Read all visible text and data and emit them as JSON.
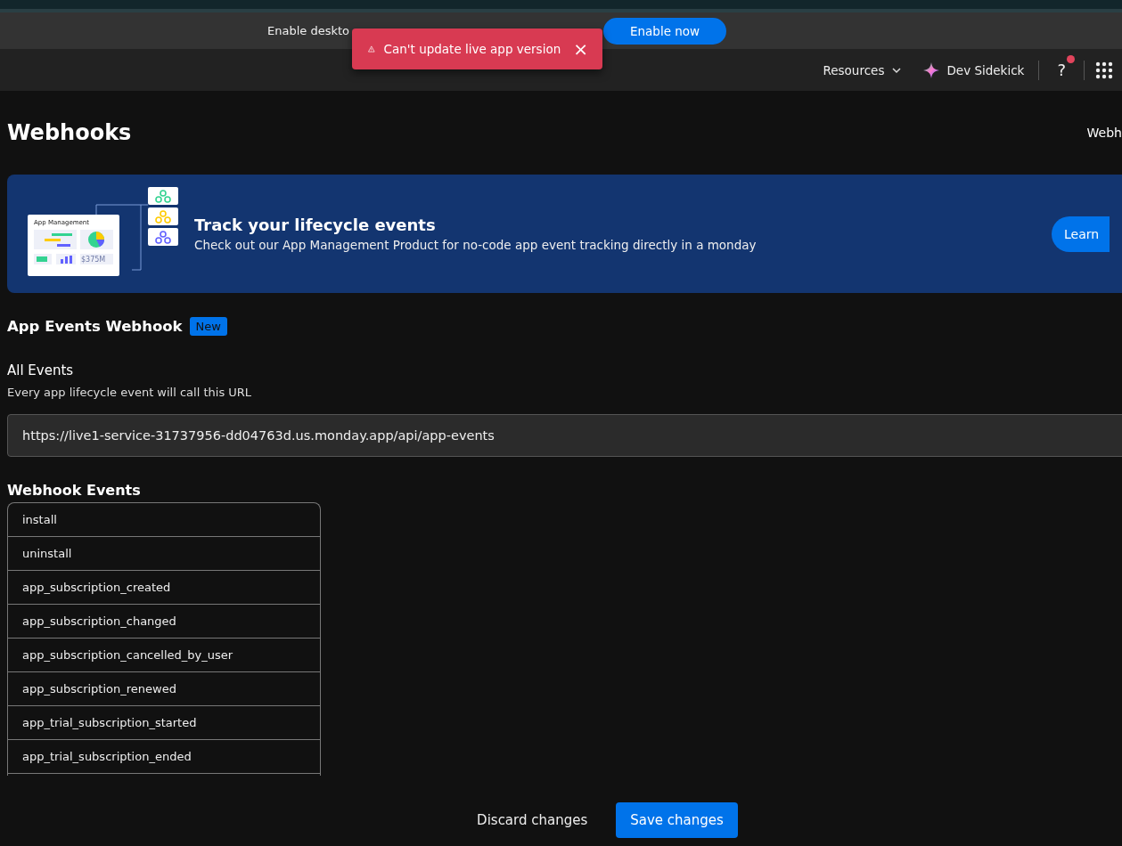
{
  "notification_bar": {
    "text": "Enable deskto",
    "button": "Enable now"
  },
  "toast": {
    "kind": "error",
    "message": "Can't update live app version",
    "close": "×"
  },
  "header": {
    "resources": "Resources",
    "sidekick": "Dev Sidekick",
    "help": "?",
    "help_badge": true
  },
  "page": {
    "title": "Webhooks",
    "right_link": "Webh"
  },
  "banner": {
    "card_title": "App Management",
    "card_amount": "$375M",
    "title": "Track your lifecycle events",
    "text": "Check out our App Management Product for no-code app event tracking directly in a monday",
    "button": "Learn"
  },
  "section": {
    "title": "App Events Webhook",
    "badge": "New"
  },
  "all_events": {
    "title": "All Events",
    "description": "Every app lifecycle event will call this URL",
    "url": "https://live1-service-31737956-dd04763d.us.monday.app/api/app-events"
  },
  "webhook_events": {
    "title": "Webhook Events",
    "items": [
      {
        "name": "install"
      },
      {
        "name": "uninstall"
      },
      {
        "name": "app_subscription_created"
      },
      {
        "name": "app_subscription_changed"
      },
      {
        "name": "app_subscription_cancelled_by_user"
      },
      {
        "name": "app_subscription_renewed"
      },
      {
        "name": "app_trial_subscription_started"
      },
      {
        "name": "app_trial_subscription_ended"
      }
    ]
  },
  "footer": {
    "discard": "Discard changes",
    "save": "Save changes"
  }
}
